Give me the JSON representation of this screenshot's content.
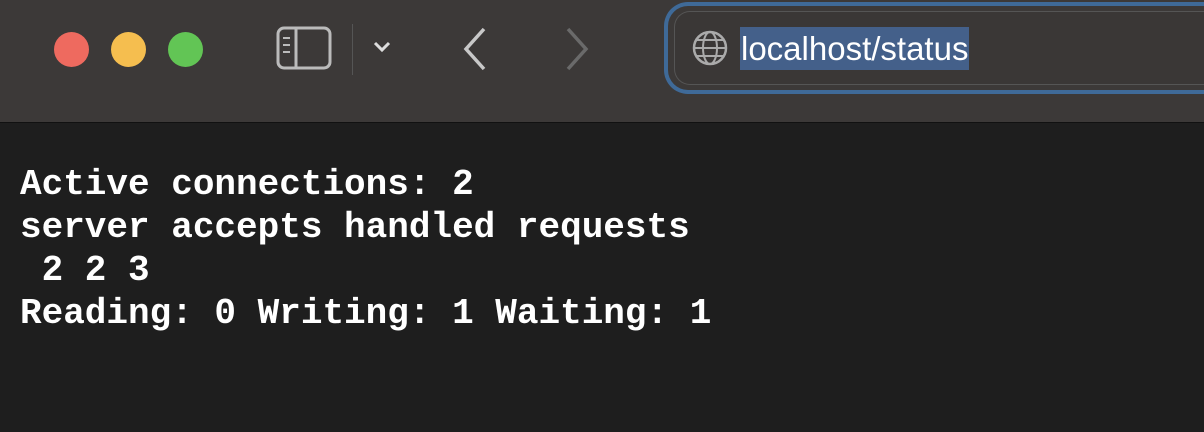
{
  "colors": {
    "close": "#ee6a5f",
    "minimize": "#f5be4f",
    "zoom": "#62c555",
    "accent": "#3f6a98"
  },
  "toolbar": {
    "url": "localhost/status"
  },
  "page": {
    "lines": [
      "Active connections: 2",
      "server accepts handled requests",
      " 2 2 3",
      "Reading: 0 Writing: 1 Waiting: 1"
    ]
  }
}
